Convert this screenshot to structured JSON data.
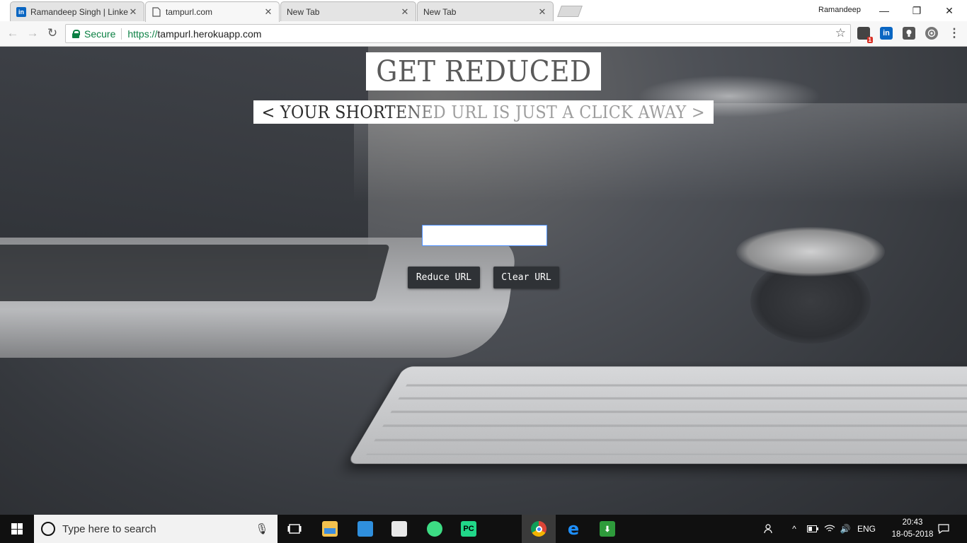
{
  "browser": {
    "tabs": [
      {
        "title": "Ramandeep Singh | Linke",
        "favicon": "linkedin-icon",
        "active": false
      },
      {
        "title": "tampurl.com",
        "favicon": "page-icon",
        "active": true
      },
      {
        "title": "New Tab",
        "favicon": "none",
        "active": false
      },
      {
        "title": "New Tab",
        "favicon": "none",
        "active": false
      }
    ],
    "profile_name": "Ramandeep",
    "window_controls": {
      "minimize": "—",
      "restore": "❐",
      "close": "✕"
    },
    "nav": {
      "back": "←",
      "forward": "→",
      "reload": "↻"
    },
    "security_label": "Secure",
    "url_scheme": "https://",
    "url_host": "tampurl.herokuapp.com",
    "extensions": [
      {
        "icon": "extension-badge-icon",
        "badge": "1",
        "color": "#444444"
      },
      {
        "icon": "linkedin-icon",
        "label": "in",
        "color": "#0a66c2"
      },
      {
        "icon": "bulb-icon",
        "label": "",
        "color": "#555555"
      },
      {
        "icon": "settings-globe-icon",
        "label": "",
        "color": "#777777"
      }
    ],
    "menu": "⋮"
  },
  "page": {
    "title": "GET REDUCED",
    "subtitle": "< YOUR SHORTENED URL IS JUST A CLICK AWAY >",
    "url_input_value": "",
    "reduce_button": "Reduce URL",
    "clear_button": "Clear URL"
  },
  "taskbar": {
    "search_placeholder": "Type here to search",
    "apps": [
      {
        "name": "task-view-icon",
        "label": "",
        "color": "#101010"
      },
      {
        "name": "file-explorer-icon",
        "label": "",
        "color": "#f2c14e"
      },
      {
        "name": "remote-desktop-icon",
        "label": "",
        "color": "#2f8fdd"
      },
      {
        "name": "store-icon",
        "label": "",
        "color": "#e8e8e8"
      },
      {
        "name": "android-studio-icon",
        "label": "",
        "color": "#3ddc84"
      },
      {
        "name": "pycharm-icon",
        "label": "PC",
        "color": "#21d789"
      },
      {
        "name": "office-icon",
        "label": "",
        "color": "#d83b01"
      },
      {
        "name": "chrome-icon",
        "label": "",
        "color": "#db4437"
      },
      {
        "name": "edge-icon",
        "label": "e",
        "color": "#0078d7"
      },
      {
        "name": "download-manager-icon",
        "label": "",
        "color": "#2e9b3b"
      }
    ],
    "language": "ENG",
    "time": "20:43",
    "date": "18-05-2018"
  }
}
